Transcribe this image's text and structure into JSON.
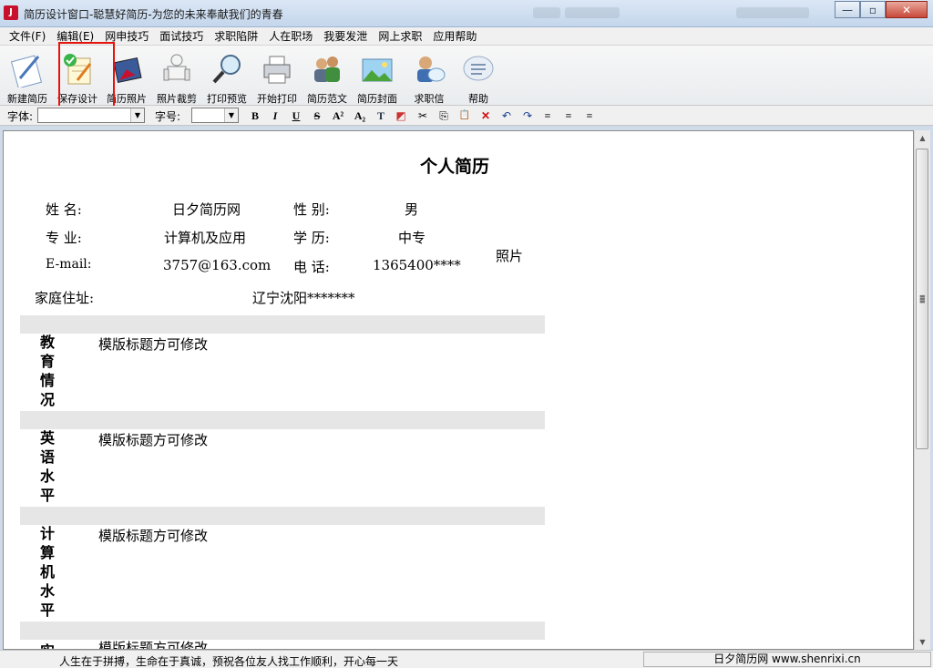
{
  "window": {
    "title": "简历设计窗口-聪慧好简历-为您的未来奉献我们的青春",
    "icon_text": "J",
    "controls": {
      "minimize": "—",
      "maximize": "▫",
      "close": "✕"
    }
  },
  "menu": [
    "文件(F)",
    "编辑(E)",
    "网申技巧",
    "面试技巧",
    "求职陷阱",
    "人在职场",
    "我要发泄",
    "网上求职",
    "应用帮助"
  ],
  "toolbar": [
    {
      "label": "新建简历",
      "icon": "new-resume-icon"
    },
    {
      "label": "保存设计",
      "icon": "save-design-icon"
    },
    {
      "label": "简历照片",
      "icon": "resume-photo-icon"
    },
    {
      "label": "照片裁剪",
      "icon": "photo-crop-icon"
    },
    {
      "label": "打印预览",
      "icon": "print-preview-icon"
    },
    {
      "label": "开始打印",
      "icon": "printer-icon"
    },
    {
      "label": "简历范文",
      "icon": "sample-resume-icon"
    },
    {
      "label": "简历封面",
      "icon": "resume-cover-icon"
    },
    {
      "label": "求职信",
      "icon": "cover-letter-icon"
    },
    {
      "label": "帮助",
      "icon": "help-icon"
    }
  ],
  "formatbar": {
    "font_label": "字体:",
    "size_label": "字号:",
    "buttons": [
      "B",
      "I",
      "U",
      "S",
      "A²",
      "A₂",
      "T",
      "◩",
      "✂",
      "⎘",
      "📋",
      "✕",
      "↶",
      "↷",
      "≡",
      "≡",
      "≡"
    ]
  },
  "resume": {
    "title": "个人简历",
    "fields": [
      {
        "label": "姓  名:",
        "value": "日夕简历网"
      },
      {
        "label": "性  别:",
        "value": "男"
      },
      {
        "label": "专  业:",
        "value": "计算机及应用"
      },
      {
        "label": "学  历:",
        "value": "中专"
      },
      {
        "label": "E-mail:",
        "value": "3757@163.com"
      },
      {
        "label": "电  话:",
        "value": "1365400****"
      }
    ],
    "photo_label": "照片",
    "address_label": "家庭住址:",
    "address_value": "辽宁沈阳*******",
    "sections": [
      {
        "title": "教育情况",
        "body": "模版标题方可修改"
      },
      {
        "title": "英语水平",
        "body": "模版标题方可修改"
      },
      {
        "title": "计算机水平",
        "body": "模版标题方可修改"
      },
      {
        "title": "实",
        "body": "模版标题方可修改"
      }
    ]
  },
  "status": {
    "left": "人生在于拼搏，生命在于真诚，预祝各位友人找工作顺利，开心每一天",
    "right": "日夕简历网 www.shenrixi.cn"
  }
}
